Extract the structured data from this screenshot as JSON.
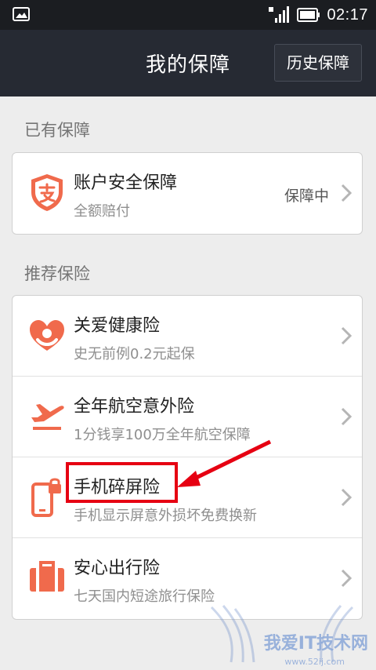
{
  "status_bar": {
    "time": "02:17"
  },
  "header": {
    "title": "我的保障",
    "history_button": "历史保障"
  },
  "existing": {
    "label": "已有保障",
    "item": {
      "title": "账户安全保障",
      "subtitle": "全额赔付",
      "status": "保障中"
    }
  },
  "recommended": {
    "label": "推荐保险",
    "items": [
      {
        "title": "关爱健康险",
        "subtitle": "史无前例0.2元起保"
      },
      {
        "title": "全年航空意外险",
        "subtitle": "1分钱享100万全年航空保障"
      },
      {
        "title": "手机碎屏险",
        "subtitle": "手机显示屏意外损坏免费换新"
      },
      {
        "title": "安心出行险",
        "subtitle": "七天国内短途旅行保险"
      }
    ]
  },
  "watermark": {
    "text": "我爱IT技术网",
    "url": "www.52ij.com"
  },
  "colors": {
    "accent": "#f06a4c",
    "header_bg": "#262a33",
    "highlight": "#e60012"
  }
}
